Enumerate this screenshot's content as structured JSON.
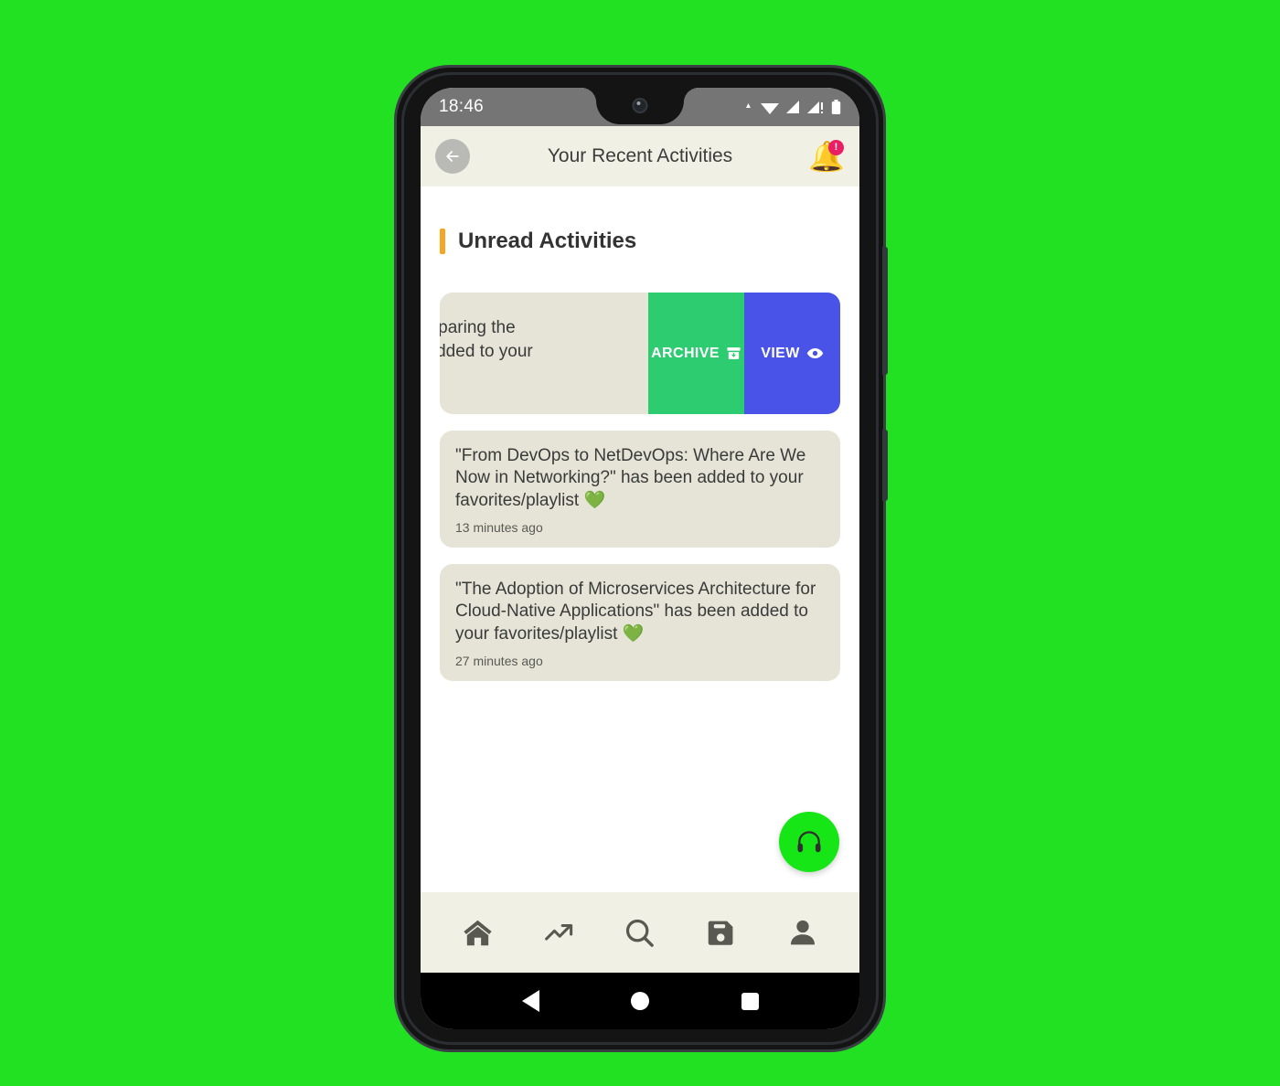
{
  "status_bar": {
    "time": "18:46",
    "icons": [
      "wifi-icon",
      "signal-icon",
      "signal-alert-icon",
      "battery-icon"
    ]
  },
  "app_bar": {
    "title": "Your Recent Activities",
    "back_icon": "back-arrow-icon",
    "bell_icon": "bell-icon",
    "bell_badge": "!"
  },
  "section": {
    "title": "Unread Activities",
    "accent_color": "#f5a623"
  },
  "cards": [
    {
      "line1": "s: Comparing the",
      "line2": "been added to your",
      "swiped": true,
      "actions": [
        {
          "label": "ARCHIVE",
          "icon": "archive-icon",
          "color": "#2ecc71"
        },
        {
          "label": "VIEW",
          "icon": "eye-icon",
          "color": "#4a53e8"
        }
      ]
    },
    {
      "message": "\"From DevOps to NetDevOps: Where Are We Now in Networking?\" has been added to your favorites/playlist",
      "heart": "💚",
      "time": "13 minutes ago"
    },
    {
      "message": "\"The Adoption of Microservices Architecture for Cloud-Native Applications\" has been added to your favorites/playlist",
      "heart": "💚",
      "time": "27 minutes ago"
    }
  ],
  "fab": {
    "icon": "headphones-icon",
    "color": "#16e616"
  },
  "bottom_nav": {
    "items": [
      {
        "icon": "home-icon",
        "name": "home"
      },
      {
        "icon": "trending-icon",
        "name": "trending"
      },
      {
        "icon": "search-icon",
        "name": "search"
      },
      {
        "icon": "save-icon",
        "name": "save"
      },
      {
        "icon": "profile-icon",
        "name": "profile"
      }
    ]
  },
  "system_nav": {
    "back": "back-triangle-icon",
    "home": "home-circle-icon",
    "recents": "recents-square-icon"
  },
  "theme": {
    "background": "#22e022",
    "card": "#e5e4d6",
    "chrome": "#f1f0e4"
  }
}
